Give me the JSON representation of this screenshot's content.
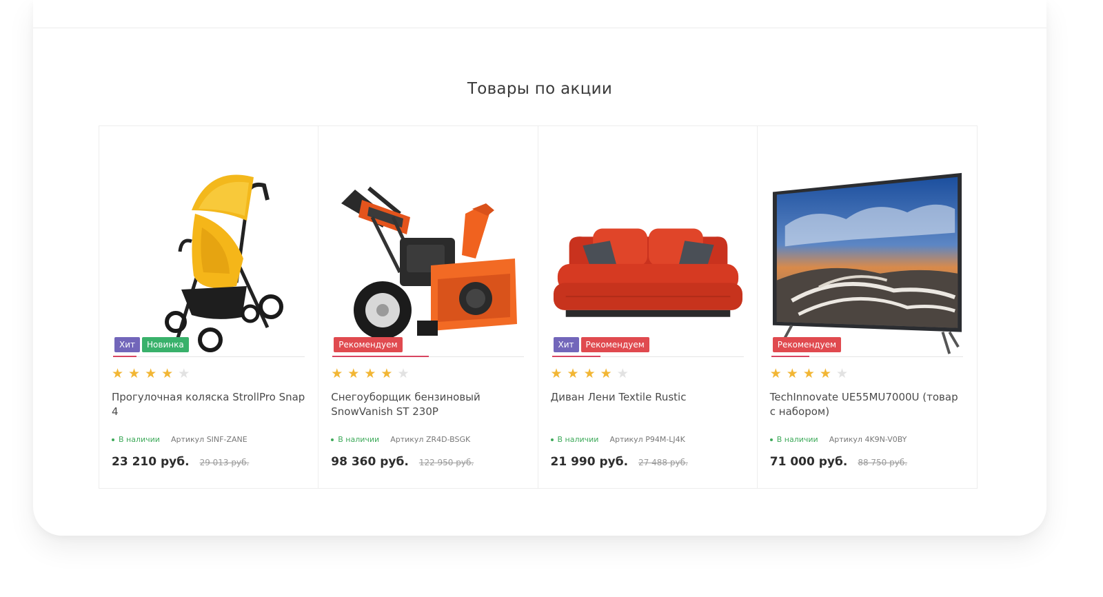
{
  "section": {
    "title": "Товары по акции"
  },
  "colors": {
    "badge_hit": "#7266ba",
    "badge_new": "#39b16b",
    "badge_recommend": "#e04a4f",
    "star_on": "#f2b634",
    "star_off": "#e2e2e2",
    "in_stock": "#3eaa5a"
  },
  "products": [
    {
      "image_icon": "stroller-image",
      "badges": [
        {
          "label": "Хит",
          "color": "#7266ba"
        },
        {
          "label": "Новинка",
          "color": "#39b16b"
        }
      ],
      "rating": 4,
      "rating_max": 5,
      "name": "Прогулочная коляска StrollPro Snap 4",
      "stock": "В наличии",
      "sku": "Артикул SINF-ZANE",
      "price": "23 210 руб.",
      "old_price": "29 013 руб."
    },
    {
      "image_icon": "snow-blower-image",
      "badges": [
        {
          "label": "Рекомендуем",
          "color": "#e04a4f"
        }
      ],
      "rating": 4,
      "rating_max": 5,
      "name": "Снегоуборщик бензиновый SnowVanish ST 230P",
      "stock": "В наличии",
      "sku": "Артикул ZR4D-BSGK",
      "price": "98 360 руб.",
      "old_price": "122 950 руб."
    },
    {
      "image_icon": "sofa-image",
      "badges": [
        {
          "label": "Хит",
          "color": "#7266ba"
        },
        {
          "label": "Рекомендуем",
          "color": "#e04a4f"
        }
      ],
      "rating": 4,
      "rating_max": 5,
      "name": "Диван Лени Textile Rustic",
      "stock": "В наличии",
      "sku": "Артикул P94M-LJ4K",
      "price": "21 990 руб.",
      "old_price": "27 488 руб."
    },
    {
      "image_icon": "tv-image",
      "badges": [
        {
          "label": "Рекомендуем",
          "color": "#e04a4f"
        }
      ],
      "rating": 4,
      "rating_max": 5,
      "name": "TechInnovate UE55MU7000U (товар с набором)",
      "stock": "В наличии",
      "sku": "Артикул 4K9N-V0BY",
      "price": "71 000 руб.",
      "old_price": "88 750 руб."
    }
  ]
}
